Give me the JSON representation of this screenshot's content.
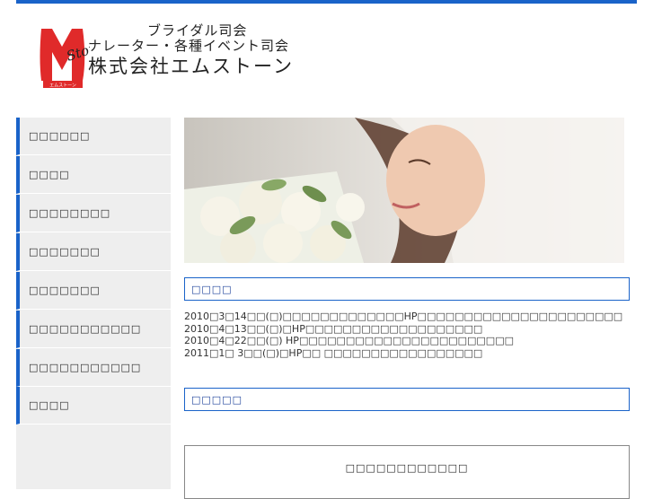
{
  "header": {
    "tagline_1": "ブライダル司会",
    "tagline_2": "ナレーター・各種イベント司会",
    "company": "株式会社エムストーン",
    "logo_script": "Stone",
    "logo_badge": "エムストーン"
  },
  "sidebar": {
    "items": [
      {
        "label": "□□□□□□"
      },
      {
        "label": "□□□□"
      },
      {
        "label": "□□□□□□□□"
      },
      {
        "label": "□□□□□□□"
      },
      {
        "label": "□□□□□□□"
      },
      {
        "label": "□□□□□□□□□□□"
      },
      {
        "label": "□□□□□□□□□□□"
      },
      {
        "label": "□□□□"
      }
    ]
  },
  "main": {
    "news_title": "□□□□",
    "news_items": [
      "2010□3□14□□(□)□□□□□□□□□□□□□HP□□□□□□□□□□□□□□□□□□□□□□",
      "2010□4□13□□(□)□HP□□□□□□□□□□□□□□□□□□□",
      "2010□4□22□□(□)  HP□□□□□□□□□□□□□□□□□□□□□□□",
      "2011□1□ 3□□(□)□HP□□  □□□□□□□□□□□□□□□□□"
    ],
    "section2_title": "□□□□□",
    "box_label": "□□□□□□□□□□□□"
  },
  "colors": {
    "accent": "#1a63c9",
    "sidebar_bg": "#eeeeee",
    "logo_red": "#e02a2a"
  }
}
